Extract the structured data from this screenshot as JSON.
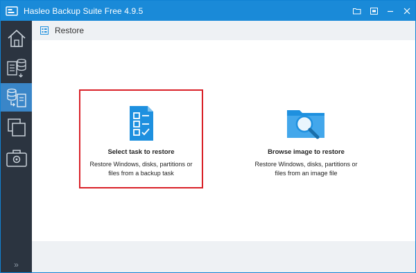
{
  "window": {
    "title": "Hasleo Backup Suite Free 4.9.5"
  },
  "header": {
    "title": "Restore"
  },
  "options": [
    {
      "title": "Select task to restore",
      "description_line1": "Restore Windows, disks, partitions or",
      "description_line2": "files from a backup task",
      "icon": "checklist-document-icon"
    },
    {
      "title": "Browse image to restore",
      "description_line1": "Restore Windows, disks, partitions or",
      "description_line2": "files from an image file",
      "icon": "folder-search-icon"
    }
  ],
  "sidebar": {
    "items": [
      {
        "icon": "home-icon"
      },
      {
        "icon": "backup-icon"
      },
      {
        "icon": "restore-icon"
      },
      {
        "icon": "clone-icon"
      },
      {
        "icon": "tools-icon"
      }
    ],
    "expand_glyph": "»"
  },
  "colors": {
    "titlebar": "#1a8ad8",
    "sidebar": "#2b3440",
    "sidebar_active": "#3a86c8",
    "icon_blue": "#1e90df",
    "selection_border": "#d92027"
  }
}
